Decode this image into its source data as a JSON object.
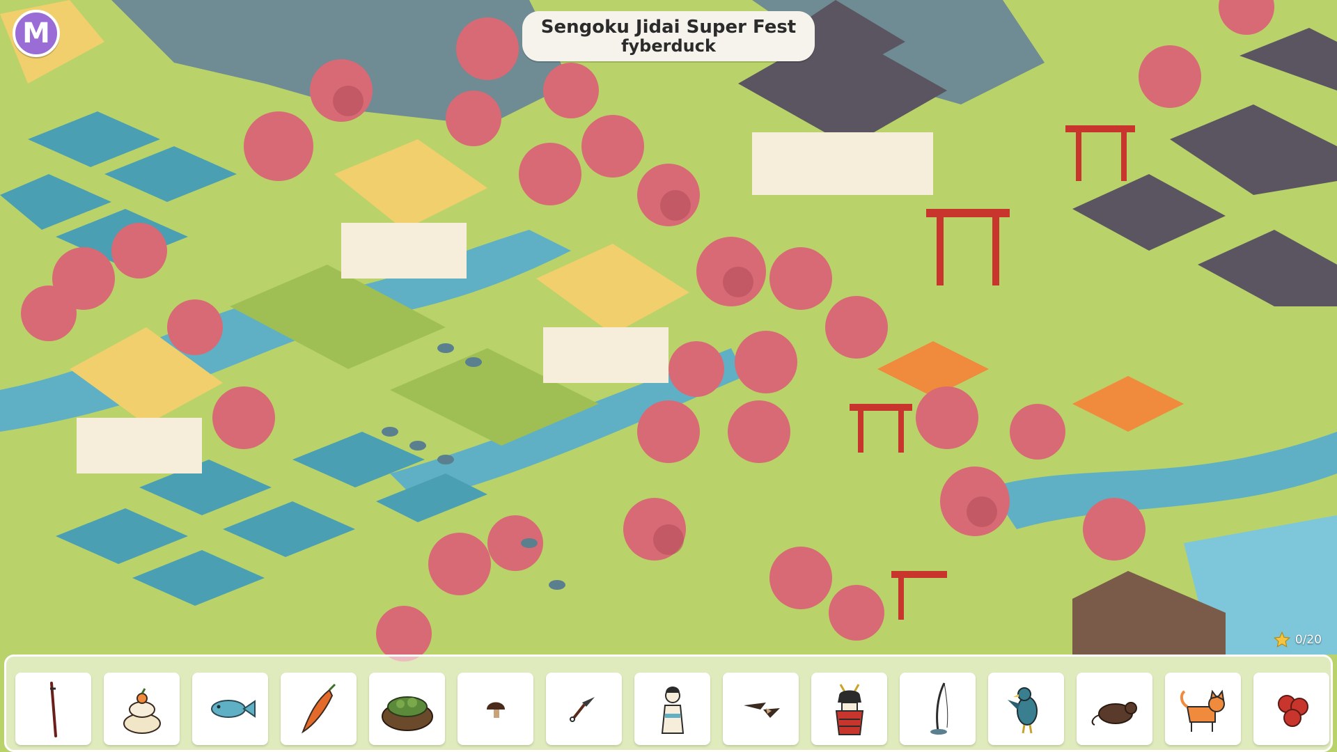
{
  "hud": {
    "menu_label": "M",
    "title_line1": "Sengoku Jidai Super Fest",
    "title_line2": "fyberduck",
    "found_count": "0/20"
  },
  "colors": {
    "grass": "#b9d36a",
    "grass_dark": "#9fbf54",
    "water": "#5fb0c4",
    "paddy": "#4a9fb3",
    "blossom": "#d86a75",
    "blossom_dark": "#b84f5c",
    "thatch": "#f0cf6c",
    "roof_dark": "#5a5560",
    "torii": "#c8352c",
    "stone": "#6f8b93",
    "stall_orange": "#f08a3c",
    "accent_purple": "#9a6cd6",
    "star": "#f5c542"
  },
  "items_to_find": [
    {
      "name": "staff",
      "icon": "staff-icon"
    },
    {
      "name": "kagami mochi",
      "icon": "mochi-icon"
    },
    {
      "name": "fish",
      "icon": "fish-icon"
    },
    {
      "name": "pepper",
      "icon": "pepper-icon"
    },
    {
      "name": "basket",
      "icon": "basket-icon"
    },
    {
      "name": "mushroom",
      "icon": "mushroom-icon"
    },
    {
      "name": "kunai",
      "icon": "kunai-icon"
    },
    {
      "name": "geisha",
      "icon": "geisha-icon"
    },
    {
      "name": "shuriken",
      "icon": "shuriken-icon"
    },
    {
      "name": "samurai armor",
      "icon": "armor-icon"
    },
    {
      "name": "fishing rod",
      "icon": "fishing-rod-icon"
    },
    {
      "name": "bird",
      "icon": "bird-icon"
    },
    {
      "name": "rat",
      "icon": "rat-icon"
    },
    {
      "name": "cat",
      "icon": "cat-icon"
    },
    {
      "name": "dango",
      "icon": "dango-icon"
    }
  ]
}
